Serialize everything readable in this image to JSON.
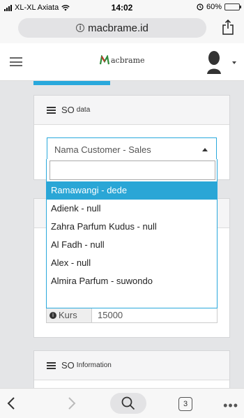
{
  "status_bar": {
    "carrier": "XL-XL Axiata",
    "time": "14:02",
    "battery": "60%",
    "battery_level": 0.6
  },
  "browser": {
    "url": "macbrame.id"
  },
  "app": {
    "logo_text": "acbrame"
  },
  "so_data": {
    "title": "SO",
    "subtitle": "data",
    "select_value": "Nama Customer - Sales",
    "search_value": "",
    "options": [
      "Ramawangi - dede",
      "Adienk - null",
      "Zahra Parfum Kudus - null",
      "Al Fadh - null",
      "Alex - null",
      "Almira Parfum - suwondo"
    ],
    "selected_index": 0
  },
  "kurs": {
    "label": "Kurs",
    "value": "15000"
  },
  "so_information": {
    "title": "SO",
    "subtitle": "Information"
  },
  "toolbar": {
    "tab_count": "3"
  },
  "colors": {
    "accent": "#29a8dc",
    "battery": "#f7d21b"
  }
}
